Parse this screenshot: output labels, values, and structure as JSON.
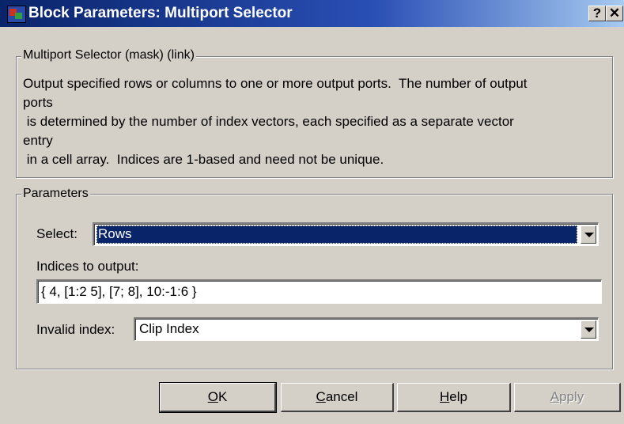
{
  "window": {
    "title": "Block Parameters: Multiport Selector",
    "help_label": "?",
    "close_label": "✕"
  },
  "description_group": {
    "legend": "Multiport Selector (mask) (link)",
    "text": "Output specified rows or columns to one or more output ports.  The number of output\nports\n is determined by the number of index vectors, each specified as a separate vector\nentry\n in a cell array.  Indices are 1-based and need not be unique."
  },
  "parameters": {
    "legend": "Parameters",
    "select_label": "Select:",
    "select_value": "Rows",
    "indices_label": "Indices to output:",
    "indices_value": "{ 4, [1:2 5], [7; 8], 10:-1:6 }",
    "invalid_label": "Invalid index:",
    "invalid_value": "Clip Index"
  },
  "buttons": {
    "ok_mnemonic": "O",
    "ok_rest": "K",
    "cancel_mnemonic": "C",
    "cancel_rest": "ancel",
    "help_mnemonic": "H",
    "help_rest": "elp",
    "apply_mnemonic": "A",
    "apply_rest": "pply"
  }
}
